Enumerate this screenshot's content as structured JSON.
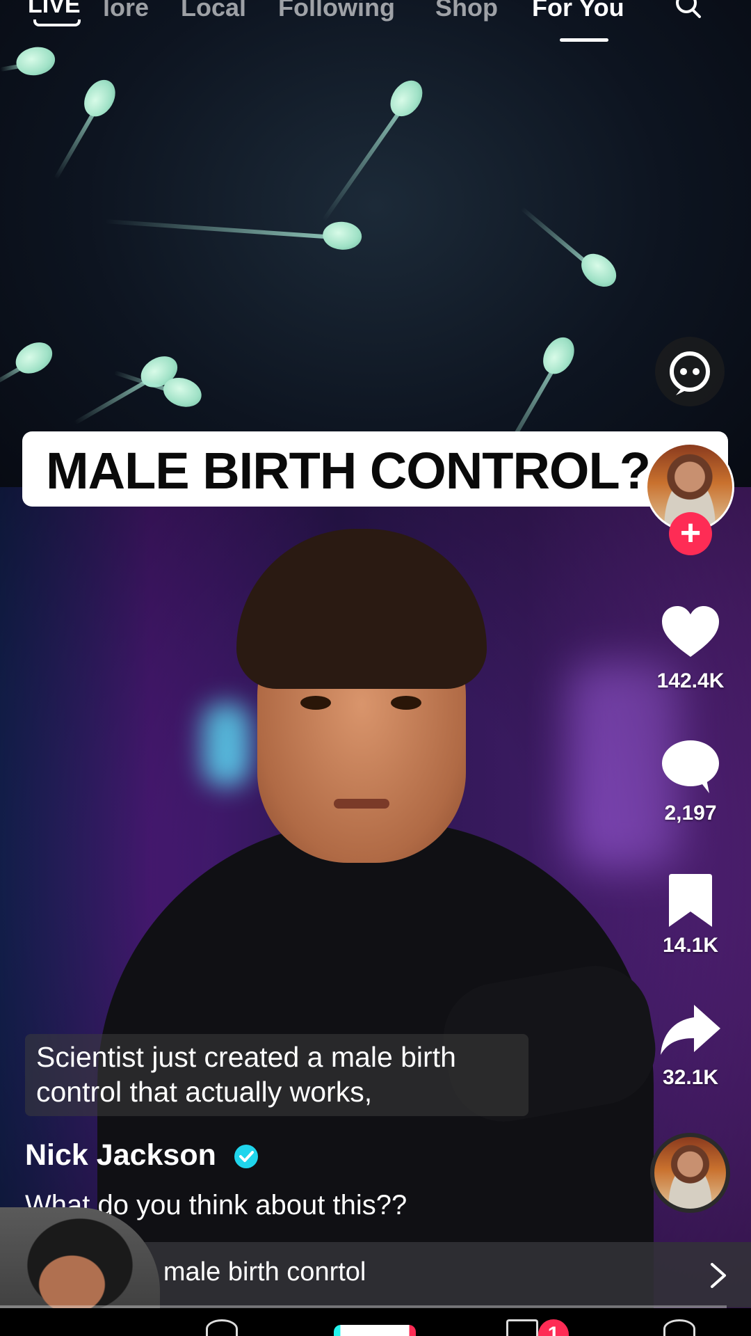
{
  "top_nav": {
    "live_label": "LIVE",
    "tabs": [
      {
        "label": "lore"
      },
      {
        "label": "Local"
      },
      {
        "label": "Following"
      },
      {
        "label": "Shop"
      },
      {
        "label": "For You"
      }
    ],
    "active_tab": "For You"
  },
  "video": {
    "title_card": "MALE BIRTH CONTROL?",
    "subtitle_line1": "Scientist just created a male birth",
    "subtitle_line2": "control that actually works,"
  },
  "post": {
    "author": "Nick Jackson",
    "verified": true,
    "description": "What do you think about this??"
  },
  "actions": {
    "likes": "142.4K",
    "comments": "2,197",
    "saves": "14.1K",
    "shares": "32.1K"
  },
  "related_search": {
    "text": "h · male birth conrtol"
  },
  "bottom_nav": {
    "inbox_badge": "1"
  },
  "colors": {
    "accent_red": "#fe2c55",
    "accent_cyan": "#25f4ee",
    "verified_blue": "#20d5ec"
  }
}
